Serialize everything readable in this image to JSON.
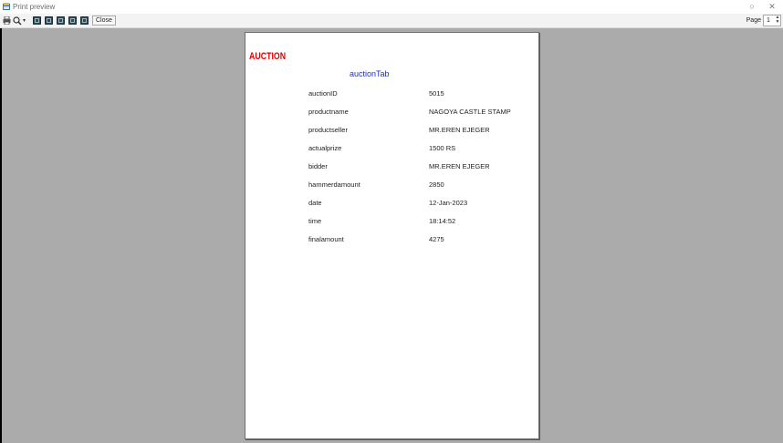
{
  "window": {
    "title": "Print preview"
  },
  "toolbar": {
    "close_label": "Close",
    "page_label": "Page",
    "page_value": "1"
  },
  "report": {
    "title": "AUCTION",
    "table_name": "auctionTab",
    "fields": [
      {
        "key": "auctionID",
        "value": "5015"
      },
      {
        "key": "productname",
        "value": "NAGOYA CASTLE STAMP"
      },
      {
        "key": "productseller",
        "value": "MR.EREN EJEGER"
      },
      {
        "key": "actualprize",
        "value": "1500 RS"
      },
      {
        "key": "bidder",
        "value": "MR.EREN EJEGER"
      },
      {
        "key": "hammerdamount",
        "value": "2850"
      },
      {
        "key": "date",
        "value": "12-Jan-2023"
      },
      {
        "key": "time",
        "value": "18:14:52"
      },
      {
        "key": "finalamount",
        "value": "4275"
      }
    ]
  }
}
